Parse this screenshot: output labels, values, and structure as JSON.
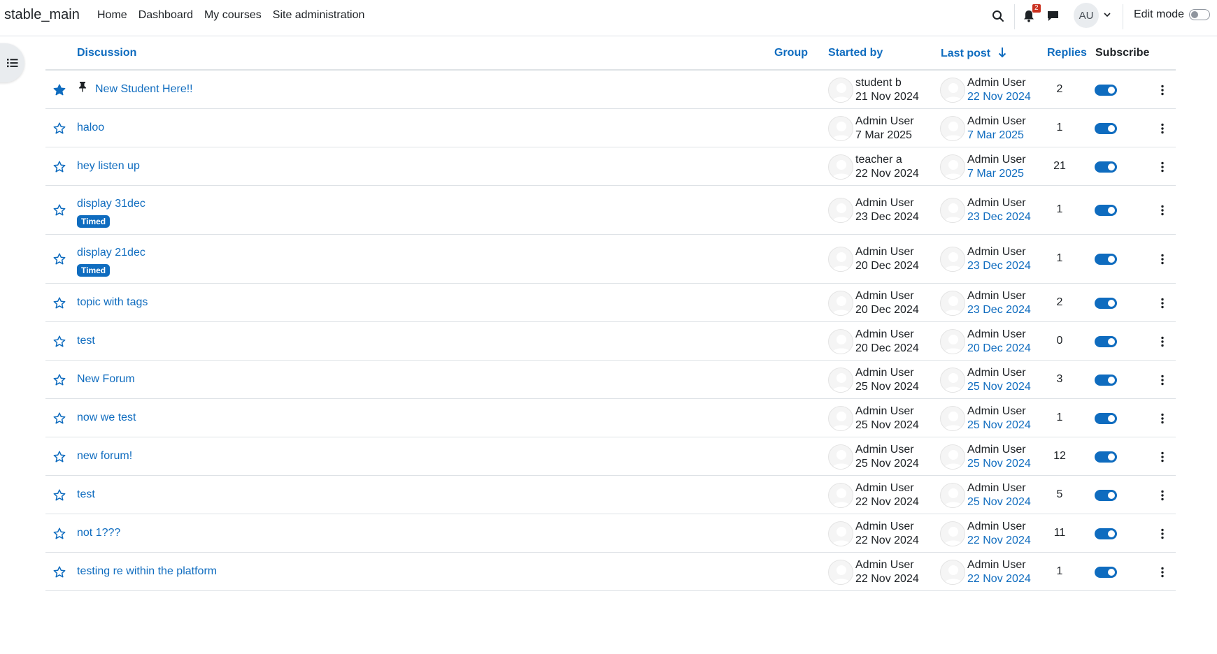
{
  "navbar": {
    "brand": "stable_main",
    "links": [
      "Home",
      "Dashboard",
      "My courses",
      "Site administration"
    ],
    "notification_count": "2",
    "avatar_initials": "AU",
    "edit_mode_label": "Edit mode"
  },
  "table": {
    "headers": {
      "discussion": "Discussion",
      "group": "Group",
      "started_by": "Started by",
      "last_post": "Last post",
      "replies": "Replies",
      "subscribe": "Subscribe"
    },
    "rows": [
      {
        "title": "New Student Here!!",
        "starred": true,
        "pinned": true,
        "timed": "",
        "started_by": "student b",
        "started_date": "21 Nov 2024",
        "last_by": "Admin User",
        "last_date": "22 Nov 2024",
        "replies": "2"
      },
      {
        "title": "haloo",
        "starred": false,
        "pinned": false,
        "timed": "",
        "started_by": "Admin User",
        "started_date": "7 Mar 2025",
        "last_by": "Admin User",
        "last_date": "7 Mar 2025",
        "replies": "1"
      },
      {
        "title": "hey listen up",
        "starred": false,
        "pinned": false,
        "timed": "",
        "started_by": "teacher a",
        "started_date": "22 Nov 2024",
        "last_by": "Admin User",
        "last_date": "7 Mar 2025",
        "replies": "21"
      },
      {
        "title": "display 31dec",
        "starred": false,
        "pinned": false,
        "timed": "Timed",
        "started_by": "Admin User",
        "started_date": "23 Dec 2024",
        "last_by": "Admin User",
        "last_date": "23 Dec 2024",
        "replies": "1"
      },
      {
        "title": "display 21dec",
        "starred": false,
        "pinned": false,
        "timed": "Timed",
        "started_by": "Admin User",
        "started_date": "20 Dec 2024",
        "last_by": "Admin User",
        "last_date": "23 Dec 2024",
        "replies": "1"
      },
      {
        "title": "topic with tags",
        "starred": false,
        "pinned": false,
        "timed": "",
        "started_by": "Admin User",
        "started_date": "20 Dec 2024",
        "last_by": "Admin User",
        "last_date": "23 Dec 2024",
        "replies": "2"
      },
      {
        "title": "test",
        "starred": false,
        "pinned": false,
        "timed": "",
        "started_by": "Admin User",
        "started_date": "20 Dec 2024",
        "last_by": "Admin User",
        "last_date": "20 Dec 2024",
        "replies": "0"
      },
      {
        "title": "New Forum",
        "starred": false,
        "pinned": false,
        "timed": "",
        "started_by": "Admin User",
        "started_date": "25 Nov 2024",
        "last_by": "Admin User",
        "last_date": "25 Nov 2024",
        "replies": "3"
      },
      {
        "title": "now we test",
        "starred": false,
        "pinned": false,
        "timed": "",
        "started_by": "Admin User",
        "started_date": "25 Nov 2024",
        "last_by": "Admin User",
        "last_date": "25 Nov 2024",
        "replies": "1"
      },
      {
        "title": "new forum!",
        "starred": false,
        "pinned": false,
        "timed": "",
        "started_by": "Admin User",
        "started_date": "25 Nov 2024",
        "last_by": "Admin User",
        "last_date": "25 Nov 2024",
        "replies": "12"
      },
      {
        "title": "test",
        "starred": false,
        "pinned": false,
        "timed": "",
        "started_by": "Admin User",
        "started_date": "22 Nov 2024",
        "last_by": "Admin User",
        "last_date": "25 Nov 2024",
        "replies": "5"
      },
      {
        "title": "not 1???",
        "starred": false,
        "pinned": false,
        "timed": "",
        "started_by": "Admin User",
        "started_date": "22 Nov 2024",
        "last_by": "Admin User",
        "last_date": "22 Nov 2024",
        "replies": "11"
      },
      {
        "title": "testing re within the platform",
        "starred": false,
        "pinned": false,
        "timed": "",
        "started_by": "Admin User",
        "started_date": "22 Nov 2024",
        "last_by": "Admin User",
        "last_date": "22 Nov 2024",
        "replies": "1"
      }
    ]
  },
  "colors": {
    "primary": "#0f6cbf",
    "text": "#1d2125",
    "border": "#dee2e6",
    "badge": "#ca3120"
  },
  "icons": {
    "search": "search-icon",
    "notifications": "bell-icon",
    "messages": "chat-bubble-icon",
    "drawer": "list-icon",
    "star": "star-icon",
    "pin": "pin-icon",
    "menu": "kebab-menu-icon",
    "sort": "arrow-down-icon"
  }
}
